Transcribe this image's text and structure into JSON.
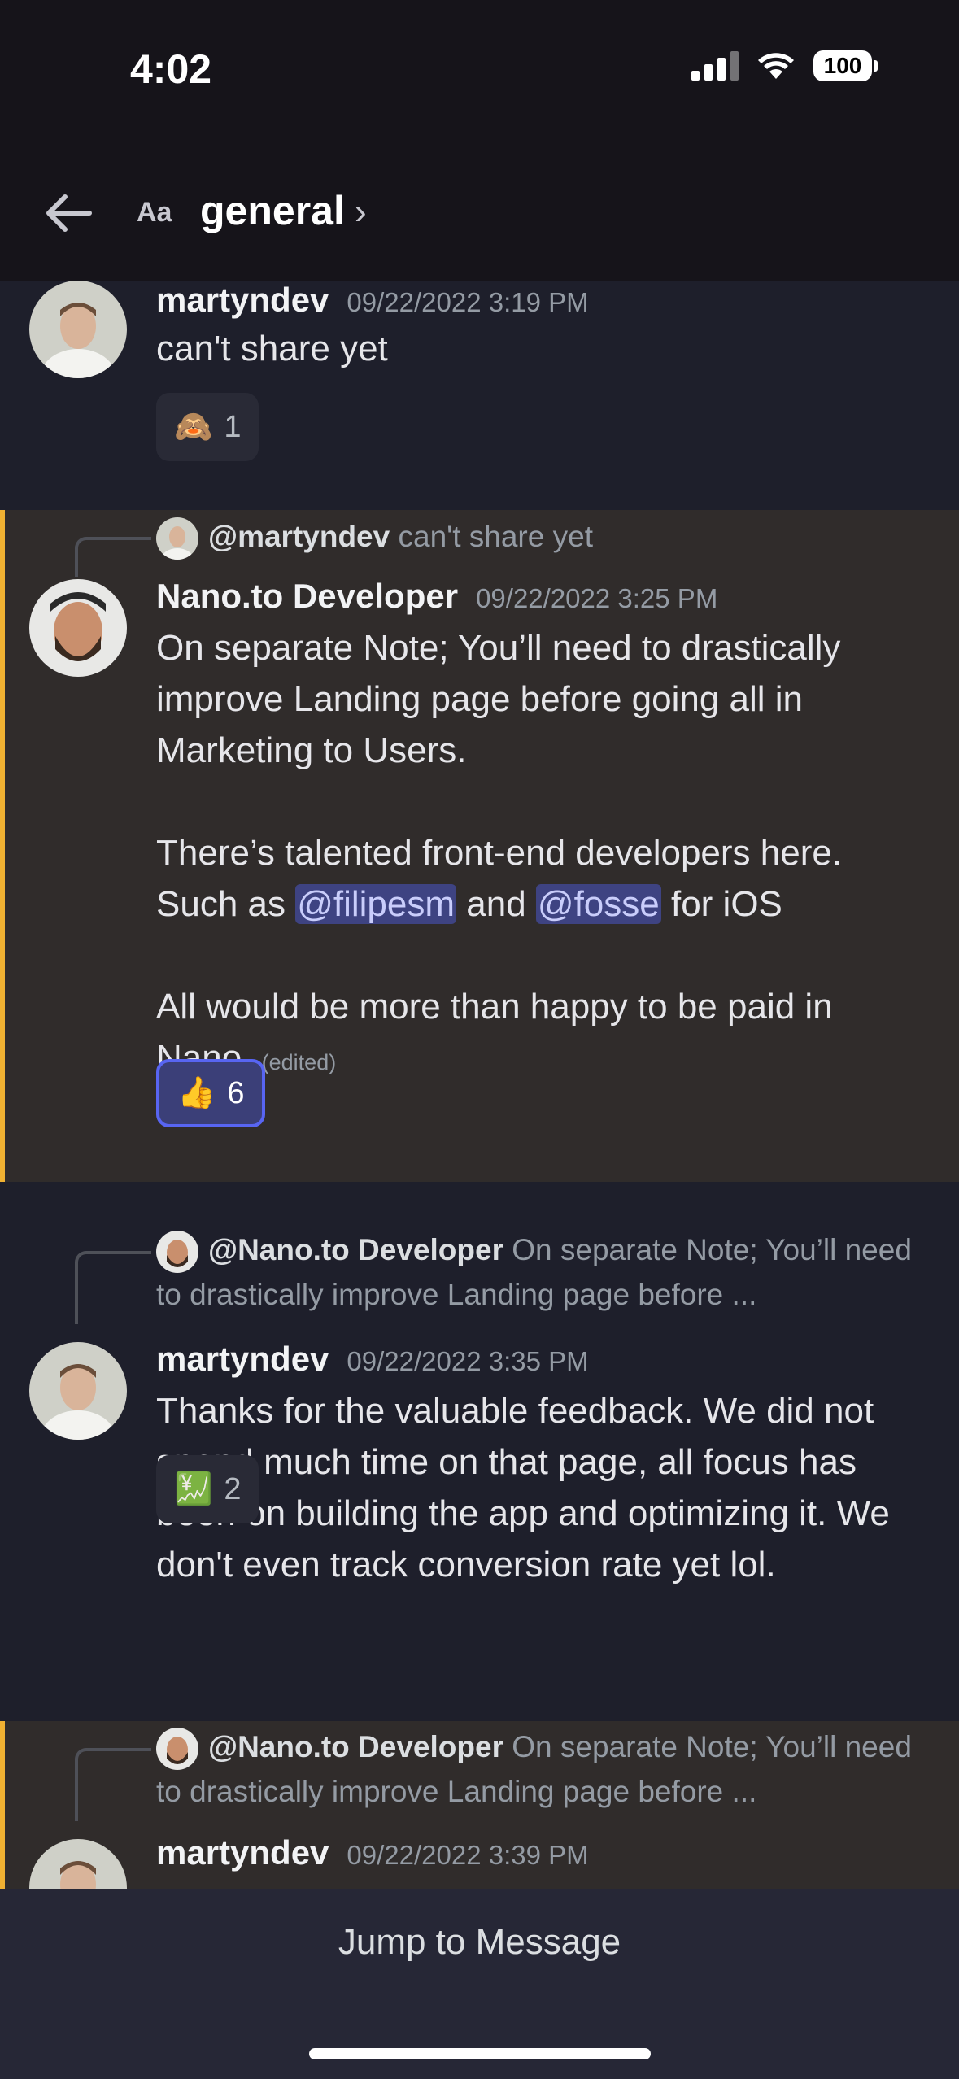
{
  "status_bar": {
    "time": "4:02",
    "battery": "100"
  },
  "header": {
    "title": "general",
    "font_toggle": "Aa"
  },
  "messages": [
    {
      "author": "martyndev",
      "timestamp": "09/22/2022 3:19 PM",
      "text": "can't share yet",
      "reaction": {
        "emoji": "🙈",
        "count": "1"
      }
    },
    {
      "reply": {
        "mention": "@martyndev",
        "preview": "can't share yet"
      },
      "author": "Nano.to Developer",
      "timestamp": "09/22/2022 3:25 PM",
      "text_p1": "On separate Note; You’ll need to drastically improve Landing page before going all in Marketing to Users.",
      "text_p2_a": "There’s talented front-end developers here. Such as ",
      "mention_1": "@filipesm",
      "text_p2_b": " and ",
      "mention_2": "@fosse",
      "text_p2_c": " for iOS",
      "text_p3": "All would be more than happy to be paid in Nano.",
      "edited": "(edited)",
      "reaction": {
        "emoji": "👍",
        "count": "6"
      }
    },
    {
      "reply": {
        "mention": "@Nano.to Developer",
        "preview": "On separate Note; You’ll need to drastically improve Landing page before ..."
      },
      "author": "martyndev",
      "timestamp": "09/22/2022 3:35 PM",
      "text": "Thanks for the valuable feedback. We did not spend much time on that page, all focus has been on building the app and optimizing it. We don't even track conversion rate yet lol.",
      "reaction": {
        "emoji": "💹",
        "count": "2"
      }
    },
    {
      "reply": {
        "mention": "@Nano.to Developer",
        "preview": "On separate Note; You’ll need to drastically improve Landing page before ..."
      },
      "author": "martyndev",
      "timestamp": "09/22/2022 3:39 PM"
    }
  ],
  "footer": {
    "jump_label": "Jump to Message"
  },
  "colors": {
    "background": "#1e1f2b",
    "highlight": "#302c2b",
    "accent_bar": "#f0b132",
    "mention": "#3e4382",
    "blurple": "#5865f2"
  }
}
